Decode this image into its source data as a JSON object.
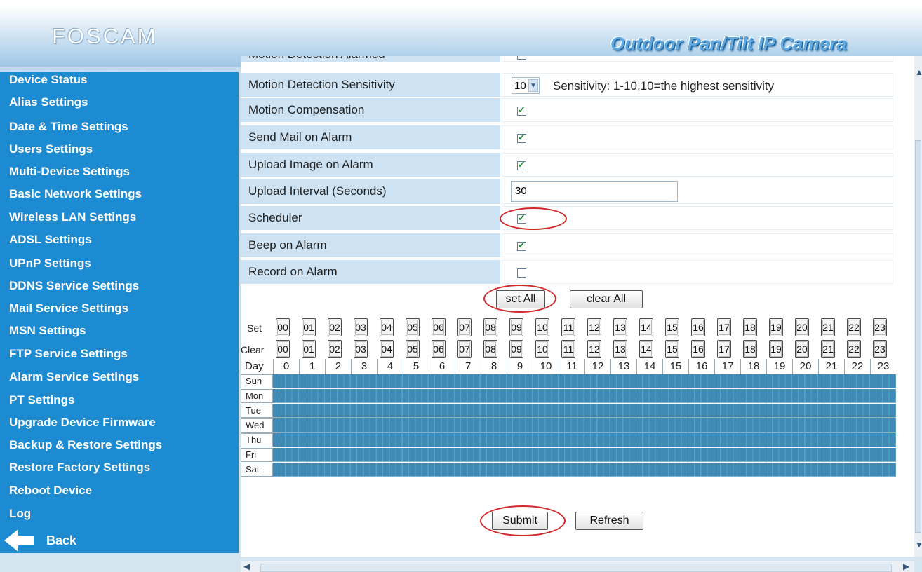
{
  "header": {
    "logo": "FOSCAM",
    "product_title": "Outdoor Pan/Tilt IP Camera"
  },
  "sidebar": {
    "items": [
      {
        "label": "Device Status"
      },
      {
        "label": "Alias Settings"
      },
      {
        "label": "Date & Time Settings"
      },
      {
        "label": "Users Settings"
      },
      {
        "label": "Multi-Device Settings"
      },
      {
        "label": "Basic Network Settings"
      },
      {
        "label": "Wireless LAN Settings"
      },
      {
        "label": "ADSL Settings"
      },
      {
        "label": "UPnP Settings"
      },
      {
        "label": "DDNS Service Settings"
      },
      {
        "label": "Mail Service Settings"
      },
      {
        "label": "MSN Settings"
      },
      {
        "label": "FTP Service Settings"
      },
      {
        "label": "Alarm Service Settings"
      },
      {
        "label": "PT Settings"
      },
      {
        "label": "Upgrade Device Firmware"
      },
      {
        "label": "Backup & Restore Settings"
      },
      {
        "label": "Restore Factory Settings"
      },
      {
        "label": "Reboot Device"
      },
      {
        "label": "Log"
      }
    ],
    "back_label": "Back"
  },
  "form": {
    "partial_label": "Motion Detection Alarmed",
    "rows": [
      {
        "label": "Motion Detection Sensitivity",
        "type": "select",
        "value": "10",
        "hint": "Sensitivity: 1-10,10=the highest sensitivity"
      },
      {
        "label": "Motion Compensation",
        "type": "checkbox",
        "checked": true
      },
      {
        "label": "Send Mail on Alarm",
        "type": "checkbox",
        "checked": true
      },
      {
        "label": "Upload Image on Alarm",
        "type": "checkbox",
        "checked": true
      },
      {
        "label": "Upload Interval (Seconds)",
        "type": "text",
        "value": "30"
      },
      {
        "label": "Scheduler",
        "type": "checkbox",
        "checked": true
      },
      {
        "label": "Beep on Alarm",
        "type": "checkbox",
        "checked": true
      },
      {
        "label": "Record on Alarm",
        "type": "checkbox",
        "checked": false
      }
    ],
    "set_all_label": "set All",
    "clear_all_label": "clear All"
  },
  "schedule": {
    "set_label": "Set",
    "clear_label": "Clear",
    "day_label": "Day",
    "hour_buttons": [
      "00",
      "01",
      "02",
      "03",
      "04",
      "05",
      "06",
      "07",
      "08",
      "09",
      "10",
      "11",
      "12",
      "13",
      "14",
      "15",
      "16",
      "17",
      "18",
      "19",
      "20",
      "21",
      "22",
      "23"
    ],
    "hour_headers": [
      "0",
      "1",
      "2",
      "3",
      "4",
      "5",
      "6",
      "7",
      "8",
      "9",
      "10",
      "11",
      "12",
      "13",
      "14",
      "15",
      "16",
      "17",
      "18",
      "19",
      "20",
      "21",
      "22",
      "23"
    ],
    "days": [
      "Sun",
      "Mon",
      "Tue",
      "Wed",
      "Thu",
      "Fri",
      "Sat"
    ],
    "cell_color": "#3e8ab4"
  },
  "actions": {
    "submit_label": "Submit",
    "refresh_label": "Refresh"
  },
  "colors": {
    "sidebar_bg": "#1d8bd1",
    "label_bg": "#cde3f4",
    "highlight": "#d22a2a"
  }
}
